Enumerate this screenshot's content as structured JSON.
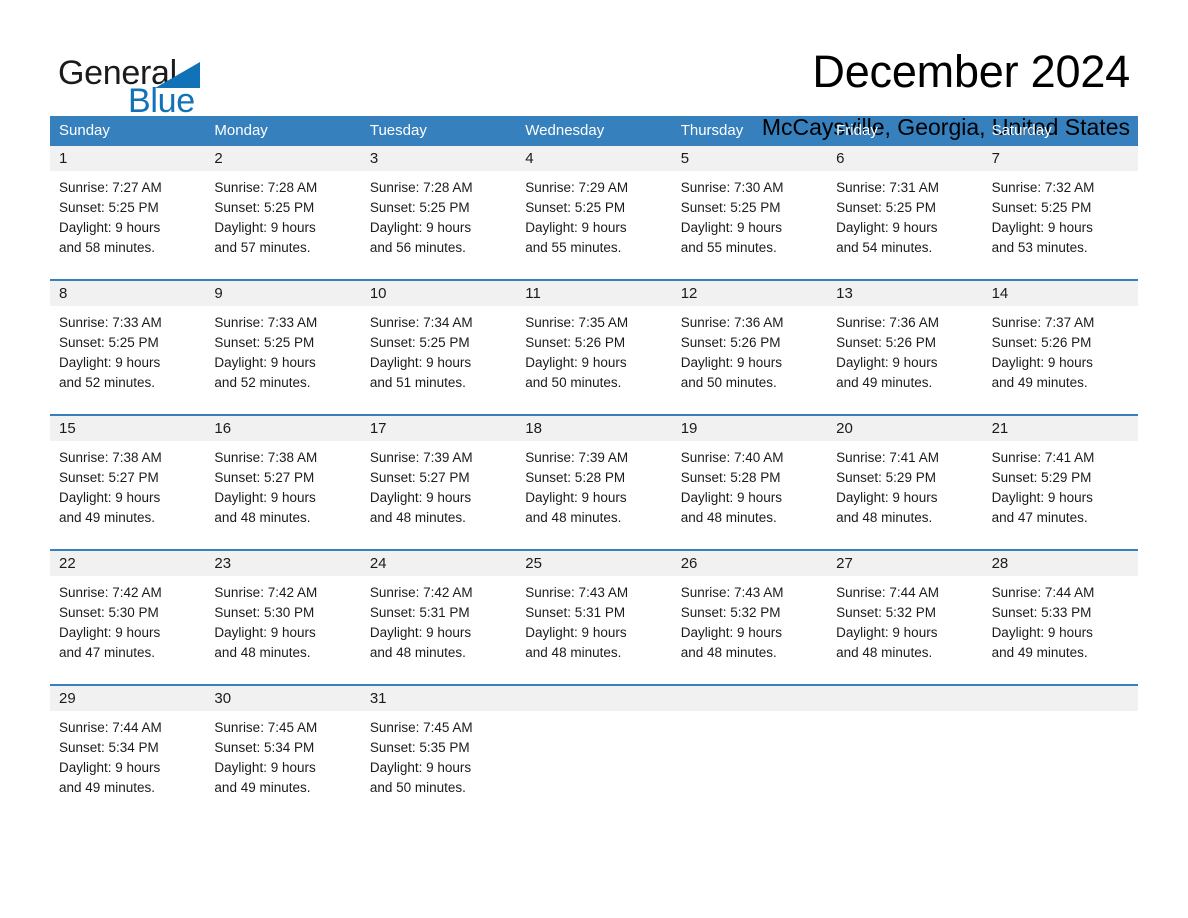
{
  "brand": {
    "name_part1": "General",
    "name_part2": "Blue",
    "triangle_icon": "triangle-icon",
    "accent_color": "#1272b8"
  },
  "header": {
    "title": "December 2024",
    "subtitle": "McCaysville, Georgia, United States"
  },
  "colors": {
    "header_band": "#3580bd",
    "day_band": "#f1f1f1",
    "text": "#1b1b1b",
    "brand_blue": "#1272b8"
  },
  "weekday_headers": [
    "Sunday",
    "Monday",
    "Tuesday",
    "Wednesday",
    "Thursday",
    "Friday",
    "Saturday"
  ],
  "labels": {
    "sunrise_prefix": "Sunrise:",
    "sunset_prefix": "Sunset:",
    "daylight_prefix": "Daylight:"
  },
  "weeks": [
    [
      {
        "day": "1",
        "sunrise": "Sunrise: 7:27 AM",
        "sunset": "Sunset: 5:25 PM",
        "daylight_line1": "Daylight: 9 hours",
        "daylight_line2": "and 58 minutes."
      },
      {
        "day": "2",
        "sunrise": "Sunrise: 7:28 AM",
        "sunset": "Sunset: 5:25 PM",
        "daylight_line1": "Daylight: 9 hours",
        "daylight_line2": "and 57 minutes."
      },
      {
        "day": "3",
        "sunrise": "Sunrise: 7:28 AM",
        "sunset": "Sunset: 5:25 PM",
        "daylight_line1": "Daylight: 9 hours",
        "daylight_line2": "and 56 minutes."
      },
      {
        "day": "4",
        "sunrise": "Sunrise: 7:29 AM",
        "sunset": "Sunset: 5:25 PM",
        "daylight_line1": "Daylight: 9 hours",
        "daylight_line2": "and 55 minutes."
      },
      {
        "day": "5",
        "sunrise": "Sunrise: 7:30 AM",
        "sunset": "Sunset: 5:25 PM",
        "daylight_line1": "Daylight: 9 hours",
        "daylight_line2": "and 55 minutes."
      },
      {
        "day": "6",
        "sunrise": "Sunrise: 7:31 AM",
        "sunset": "Sunset: 5:25 PM",
        "daylight_line1": "Daylight: 9 hours",
        "daylight_line2": "and 54 minutes."
      },
      {
        "day": "7",
        "sunrise": "Sunrise: 7:32 AM",
        "sunset": "Sunset: 5:25 PM",
        "daylight_line1": "Daylight: 9 hours",
        "daylight_line2": "and 53 minutes."
      }
    ],
    [
      {
        "day": "8",
        "sunrise": "Sunrise: 7:33 AM",
        "sunset": "Sunset: 5:25 PM",
        "daylight_line1": "Daylight: 9 hours",
        "daylight_line2": "and 52 minutes."
      },
      {
        "day": "9",
        "sunrise": "Sunrise: 7:33 AM",
        "sunset": "Sunset: 5:25 PM",
        "daylight_line1": "Daylight: 9 hours",
        "daylight_line2": "and 52 minutes."
      },
      {
        "day": "10",
        "sunrise": "Sunrise: 7:34 AM",
        "sunset": "Sunset: 5:25 PM",
        "daylight_line1": "Daylight: 9 hours",
        "daylight_line2": "and 51 minutes."
      },
      {
        "day": "11",
        "sunrise": "Sunrise: 7:35 AM",
        "sunset": "Sunset: 5:26 PM",
        "daylight_line1": "Daylight: 9 hours",
        "daylight_line2": "and 50 minutes."
      },
      {
        "day": "12",
        "sunrise": "Sunrise: 7:36 AM",
        "sunset": "Sunset: 5:26 PM",
        "daylight_line1": "Daylight: 9 hours",
        "daylight_line2": "and 50 minutes."
      },
      {
        "day": "13",
        "sunrise": "Sunrise: 7:36 AM",
        "sunset": "Sunset: 5:26 PM",
        "daylight_line1": "Daylight: 9 hours",
        "daylight_line2": "and 49 minutes."
      },
      {
        "day": "14",
        "sunrise": "Sunrise: 7:37 AM",
        "sunset": "Sunset: 5:26 PM",
        "daylight_line1": "Daylight: 9 hours",
        "daylight_line2": "and 49 minutes."
      }
    ],
    [
      {
        "day": "15",
        "sunrise": "Sunrise: 7:38 AM",
        "sunset": "Sunset: 5:27 PM",
        "daylight_line1": "Daylight: 9 hours",
        "daylight_line2": "and 49 minutes."
      },
      {
        "day": "16",
        "sunrise": "Sunrise: 7:38 AM",
        "sunset": "Sunset: 5:27 PM",
        "daylight_line1": "Daylight: 9 hours",
        "daylight_line2": "and 48 minutes."
      },
      {
        "day": "17",
        "sunrise": "Sunrise: 7:39 AM",
        "sunset": "Sunset: 5:27 PM",
        "daylight_line1": "Daylight: 9 hours",
        "daylight_line2": "and 48 minutes."
      },
      {
        "day": "18",
        "sunrise": "Sunrise: 7:39 AM",
        "sunset": "Sunset: 5:28 PM",
        "daylight_line1": "Daylight: 9 hours",
        "daylight_line2": "and 48 minutes."
      },
      {
        "day": "19",
        "sunrise": "Sunrise: 7:40 AM",
        "sunset": "Sunset: 5:28 PM",
        "daylight_line1": "Daylight: 9 hours",
        "daylight_line2": "and 48 minutes."
      },
      {
        "day": "20",
        "sunrise": "Sunrise: 7:41 AM",
        "sunset": "Sunset: 5:29 PM",
        "daylight_line1": "Daylight: 9 hours",
        "daylight_line2": "and 48 minutes."
      },
      {
        "day": "21",
        "sunrise": "Sunrise: 7:41 AM",
        "sunset": "Sunset: 5:29 PM",
        "daylight_line1": "Daylight: 9 hours",
        "daylight_line2": "and 47 minutes."
      }
    ],
    [
      {
        "day": "22",
        "sunrise": "Sunrise: 7:42 AM",
        "sunset": "Sunset: 5:30 PM",
        "daylight_line1": "Daylight: 9 hours",
        "daylight_line2": "and 47 minutes."
      },
      {
        "day": "23",
        "sunrise": "Sunrise: 7:42 AM",
        "sunset": "Sunset: 5:30 PM",
        "daylight_line1": "Daylight: 9 hours",
        "daylight_line2": "and 48 minutes."
      },
      {
        "day": "24",
        "sunrise": "Sunrise: 7:42 AM",
        "sunset": "Sunset: 5:31 PM",
        "daylight_line1": "Daylight: 9 hours",
        "daylight_line2": "and 48 minutes."
      },
      {
        "day": "25",
        "sunrise": "Sunrise: 7:43 AM",
        "sunset": "Sunset: 5:31 PM",
        "daylight_line1": "Daylight: 9 hours",
        "daylight_line2": "and 48 minutes."
      },
      {
        "day": "26",
        "sunrise": "Sunrise: 7:43 AM",
        "sunset": "Sunset: 5:32 PM",
        "daylight_line1": "Daylight: 9 hours",
        "daylight_line2": "and 48 minutes."
      },
      {
        "day": "27",
        "sunrise": "Sunrise: 7:44 AM",
        "sunset": "Sunset: 5:32 PM",
        "daylight_line1": "Daylight: 9 hours",
        "daylight_line2": "and 48 minutes."
      },
      {
        "day": "28",
        "sunrise": "Sunrise: 7:44 AM",
        "sunset": "Sunset: 5:33 PM",
        "daylight_line1": "Daylight: 9 hours",
        "daylight_line2": "and 49 minutes."
      }
    ],
    [
      {
        "day": "29",
        "sunrise": "Sunrise: 7:44 AM",
        "sunset": "Sunset: 5:34 PM",
        "daylight_line1": "Daylight: 9 hours",
        "daylight_line2": "and 49 minutes."
      },
      {
        "day": "30",
        "sunrise": "Sunrise: 7:45 AM",
        "sunset": "Sunset: 5:34 PM",
        "daylight_line1": "Daylight: 9 hours",
        "daylight_line2": "and 49 minutes."
      },
      {
        "day": "31",
        "sunrise": "Sunrise: 7:45 AM",
        "sunset": "Sunset: 5:35 PM",
        "daylight_line1": "Daylight: 9 hours",
        "daylight_line2": "and 50 minutes."
      },
      {
        "day": "",
        "sunrise": "",
        "sunset": "",
        "daylight_line1": "",
        "daylight_line2": ""
      },
      {
        "day": "",
        "sunrise": "",
        "sunset": "",
        "daylight_line1": "",
        "daylight_line2": ""
      },
      {
        "day": "",
        "sunrise": "",
        "sunset": "",
        "daylight_line1": "",
        "daylight_line2": ""
      },
      {
        "day": "",
        "sunrise": "",
        "sunset": "",
        "daylight_line1": "",
        "daylight_line2": ""
      }
    ]
  ]
}
